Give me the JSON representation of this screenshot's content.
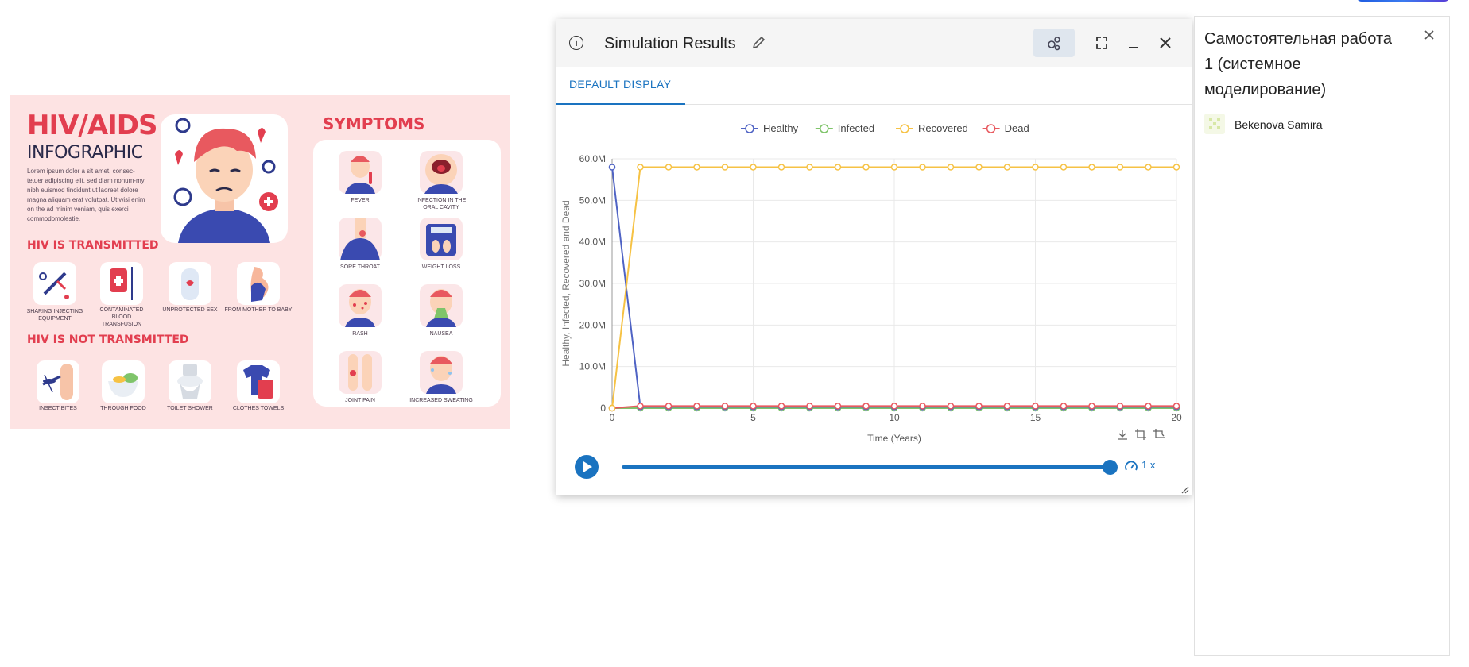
{
  "infographic": {
    "title": "HIV/AIDS",
    "subtitle": "INFOGRAPHIC",
    "lorem": "Lorem ipsum dolor a sit amet, consec-tetuer adipiscing elit, sed diam nonum-my nibh euismod tincidunt ut laoreet dolore magna aliquam erat volutpat. Ut wisi enim on the ad minim veniam, quis exerci commodomolestie.",
    "transmitted_heading": "HIV IS TRANSMITTED",
    "transmitted": [
      {
        "label": "SHARING INJECTING EQUIPMENT",
        "icon": "syringe-icon"
      },
      {
        "label": "CONTAMINATED BLOOD TRANSFUSION",
        "icon": "blood-bag-icon"
      },
      {
        "label": "UNPROTECTED SEX",
        "icon": "condom-icon"
      },
      {
        "label": "FROM MOTHER TO BABY",
        "icon": "pregnant-mother-icon"
      }
    ],
    "not_transmitted_heading": "HIV IS NOT TRANSMITTED",
    "not_transmitted": [
      {
        "label": "INSECT BITES",
        "icon": "mosquito-icon"
      },
      {
        "label": "THROUGH FOOD",
        "icon": "food-bowl-icon"
      },
      {
        "label": "TOILET SHOWER",
        "icon": "toilet-icon"
      },
      {
        "label": "CLOTHES TOWELS",
        "icon": "clothes-icon"
      }
    ],
    "symptoms_heading": "SYMPTOMS",
    "symptoms": [
      {
        "label": "FEVER",
        "icon": "fever-icon"
      },
      {
        "label": "INFECTION IN THE ORAL CAVITY",
        "icon": "mouth-infection-icon"
      },
      {
        "label": "SORE THROAT",
        "icon": "sore-throat-icon"
      },
      {
        "label": "WEIGHT LOSS",
        "icon": "scale-icon"
      },
      {
        "label": "RASH",
        "icon": "rash-icon"
      },
      {
        "label": "NAUSEA",
        "icon": "nausea-icon"
      },
      {
        "label": "JOINT PAIN",
        "icon": "joint-pain-icon"
      },
      {
        "label": "INCREASED SWEATING",
        "icon": "sweating-icon"
      }
    ],
    "colors": {
      "accent": "#e23e4f",
      "background": "#fde3e3",
      "navy": "#2e3a8c"
    }
  },
  "window": {
    "title": "Simulation Results",
    "tab": "DEFAULT DISPLAY",
    "speed": "1 x",
    "playback_progress": 1.0,
    "icons": [
      "info-icon",
      "pencil-icon",
      "share-nodes-icon",
      "fullscreen-icon",
      "minimize-icon",
      "close-icon",
      "download-icon",
      "crop-icon",
      "crop-reset-icon",
      "play-icon",
      "speedometer-icon"
    ],
    "colors": {
      "accent": "#1a73c0",
      "active_button": "#dfe6ee"
    }
  },
  "chart_data": {
    "type": "line",
    "xlabel": "Time (Years)",
    "ylabel": "Healthy, Infected, Recovered and Dead",
    "xlim": [
      0,
      20
    ],
    "ylim": [
      0,
      60000000
    ],
    "x_ticks": [
      "0",
      "5",
      "10",
      "15",
      "20"
    ],
    "y_ticks": [
      "0",
      "10.0M",
      "20.0M",
      "30.0M",
      "40.0M",
      "50.0M",
      "60.0M"
    ],
    "grid": true,
    "legend_position": "top-center",
    "x": [
      0,
      1,
      2,
      3,
      4,
      5,
      6,
      7,
      8,
      9,
      10,
      11,
      12,
      13,
      14,
      15,
      16,
      17,
      18,
      19,
      20
    ],
    "series": [
      {
        "name": "Healthy",
        "color": "#4f63c4",
        "values": [
          58000000,
          300000,
          300000,
          300000,
          300000,
          300000,
          300000,
          300000,
          300000,
          300000,
          300000,
          300000,
          300000,
          300000,
          300000,
          300000,
          300000,
          300000,
          300000,
          300000,
          300000
        ]
      },
      {
        "name": "Infected",
        "color": "#7fc46a",
        "values": [
          0,
          0,
          0,
          0,
          0,
          0,
          0,
          0,
          0,
          0,
          0,
          0,
          0,
          0,
          0,
          0,
          0,
          0,
          0,
          0,
          0
        ]
      },
      {
        "name": "Recovered",
        "color": "#f6c244",
        "values": [
          0,
          58000000,
          58000000,
          58000000,
          58000000,
          58000000,
          58000000,
          58000000,
          58000000,
          58000000,
          58000000,
          58000000,
          58000000,
          58000000,
          58000000,
          58000000,
          58000000,
          58000000,
          58000000,
          58000000,
          58000000
        ]
      },
      {
        "name": "Dead",
        "color": "#e8595f",
        "values": [
          0,
          500000,
          500000,
          500000,
          500000,
          500000,
          500000,
          500000,
          500000,
          500000,
          500000,
          500000,
          500000,
          500000,
          500000,
          500000,
          500000,
          500000,
          500000,
          500000,
          500000
        ]
      }
    ]
  },
  "panel": {
    "title": "Самостоятельная работа 1 (системное моделирование)",
    "user": "Bekenova Samira",
    "close_icon": "close-icon"
  }
}
